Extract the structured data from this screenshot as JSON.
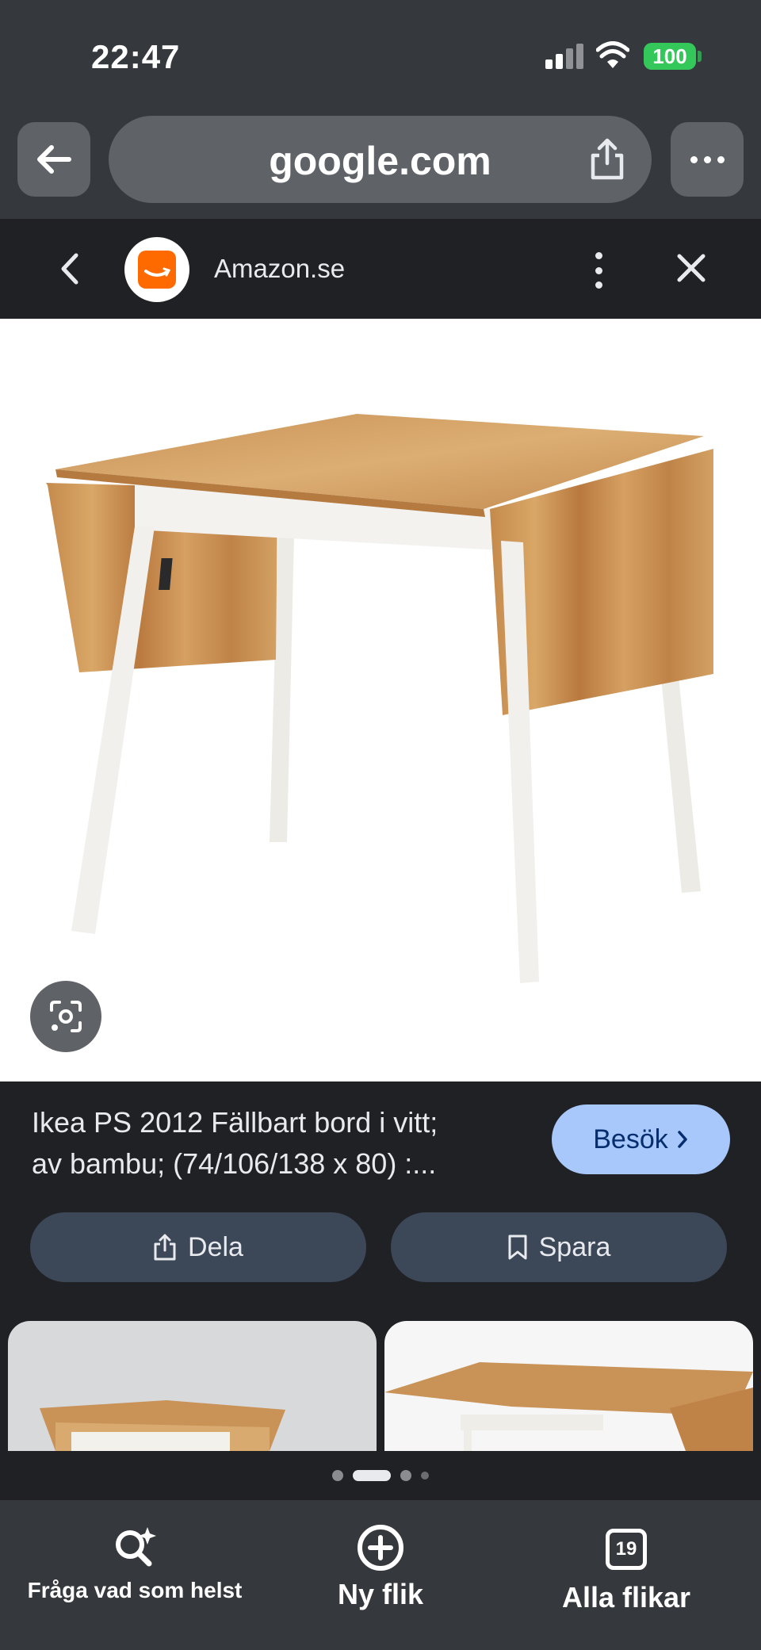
{
  "status_bar": {
    "time": "22:47",
    "battery": "100"
  },
  "browser": {
    "url": "google.com"
  },
  "source": {
    "name": "Amazon.se"
  },
  "result": {
    "title_line1": "Ikea PS 2012 Fällbart bord i vitt;",
    "title_line2": "av bambu; (74/106/138 x 80) :...",
    "visit_label": "Besök",
    "share_label": "Dela",
    "save_label": "Spara"
  },
  "pager": {
    "total": 4,
    "active_index": 1
  },
  "toolbar": {
    "ask_label": "Fråga vad som helst",
    "new_tab_label": "Ny flik",
    "all_tabs_label": "Alla flikar",
    "tab_count": "19"
  },
  "icons": [
    "back-arrow-icon",
    "share-icon",
    "more-icon",
    "chevron-left-icon",
    "amazon-logo",
    "kebab-icon",
    "close-icon",
    "lens-icon",
    "chevron-right-icon",
    "bookmark-icon",
    "search-sparkle-icon",
    "plus-circle-icon",
    "tabs-icon"
  ],
  "colors": {
    "chrome": "#35383c",
    "panel": "#202124",
    "visit_button": "#a8c7fa",
    "action_button": "#3c4858",
    "battery": "#34c759",
    "amazon": "#ff6a00"
  }
}
